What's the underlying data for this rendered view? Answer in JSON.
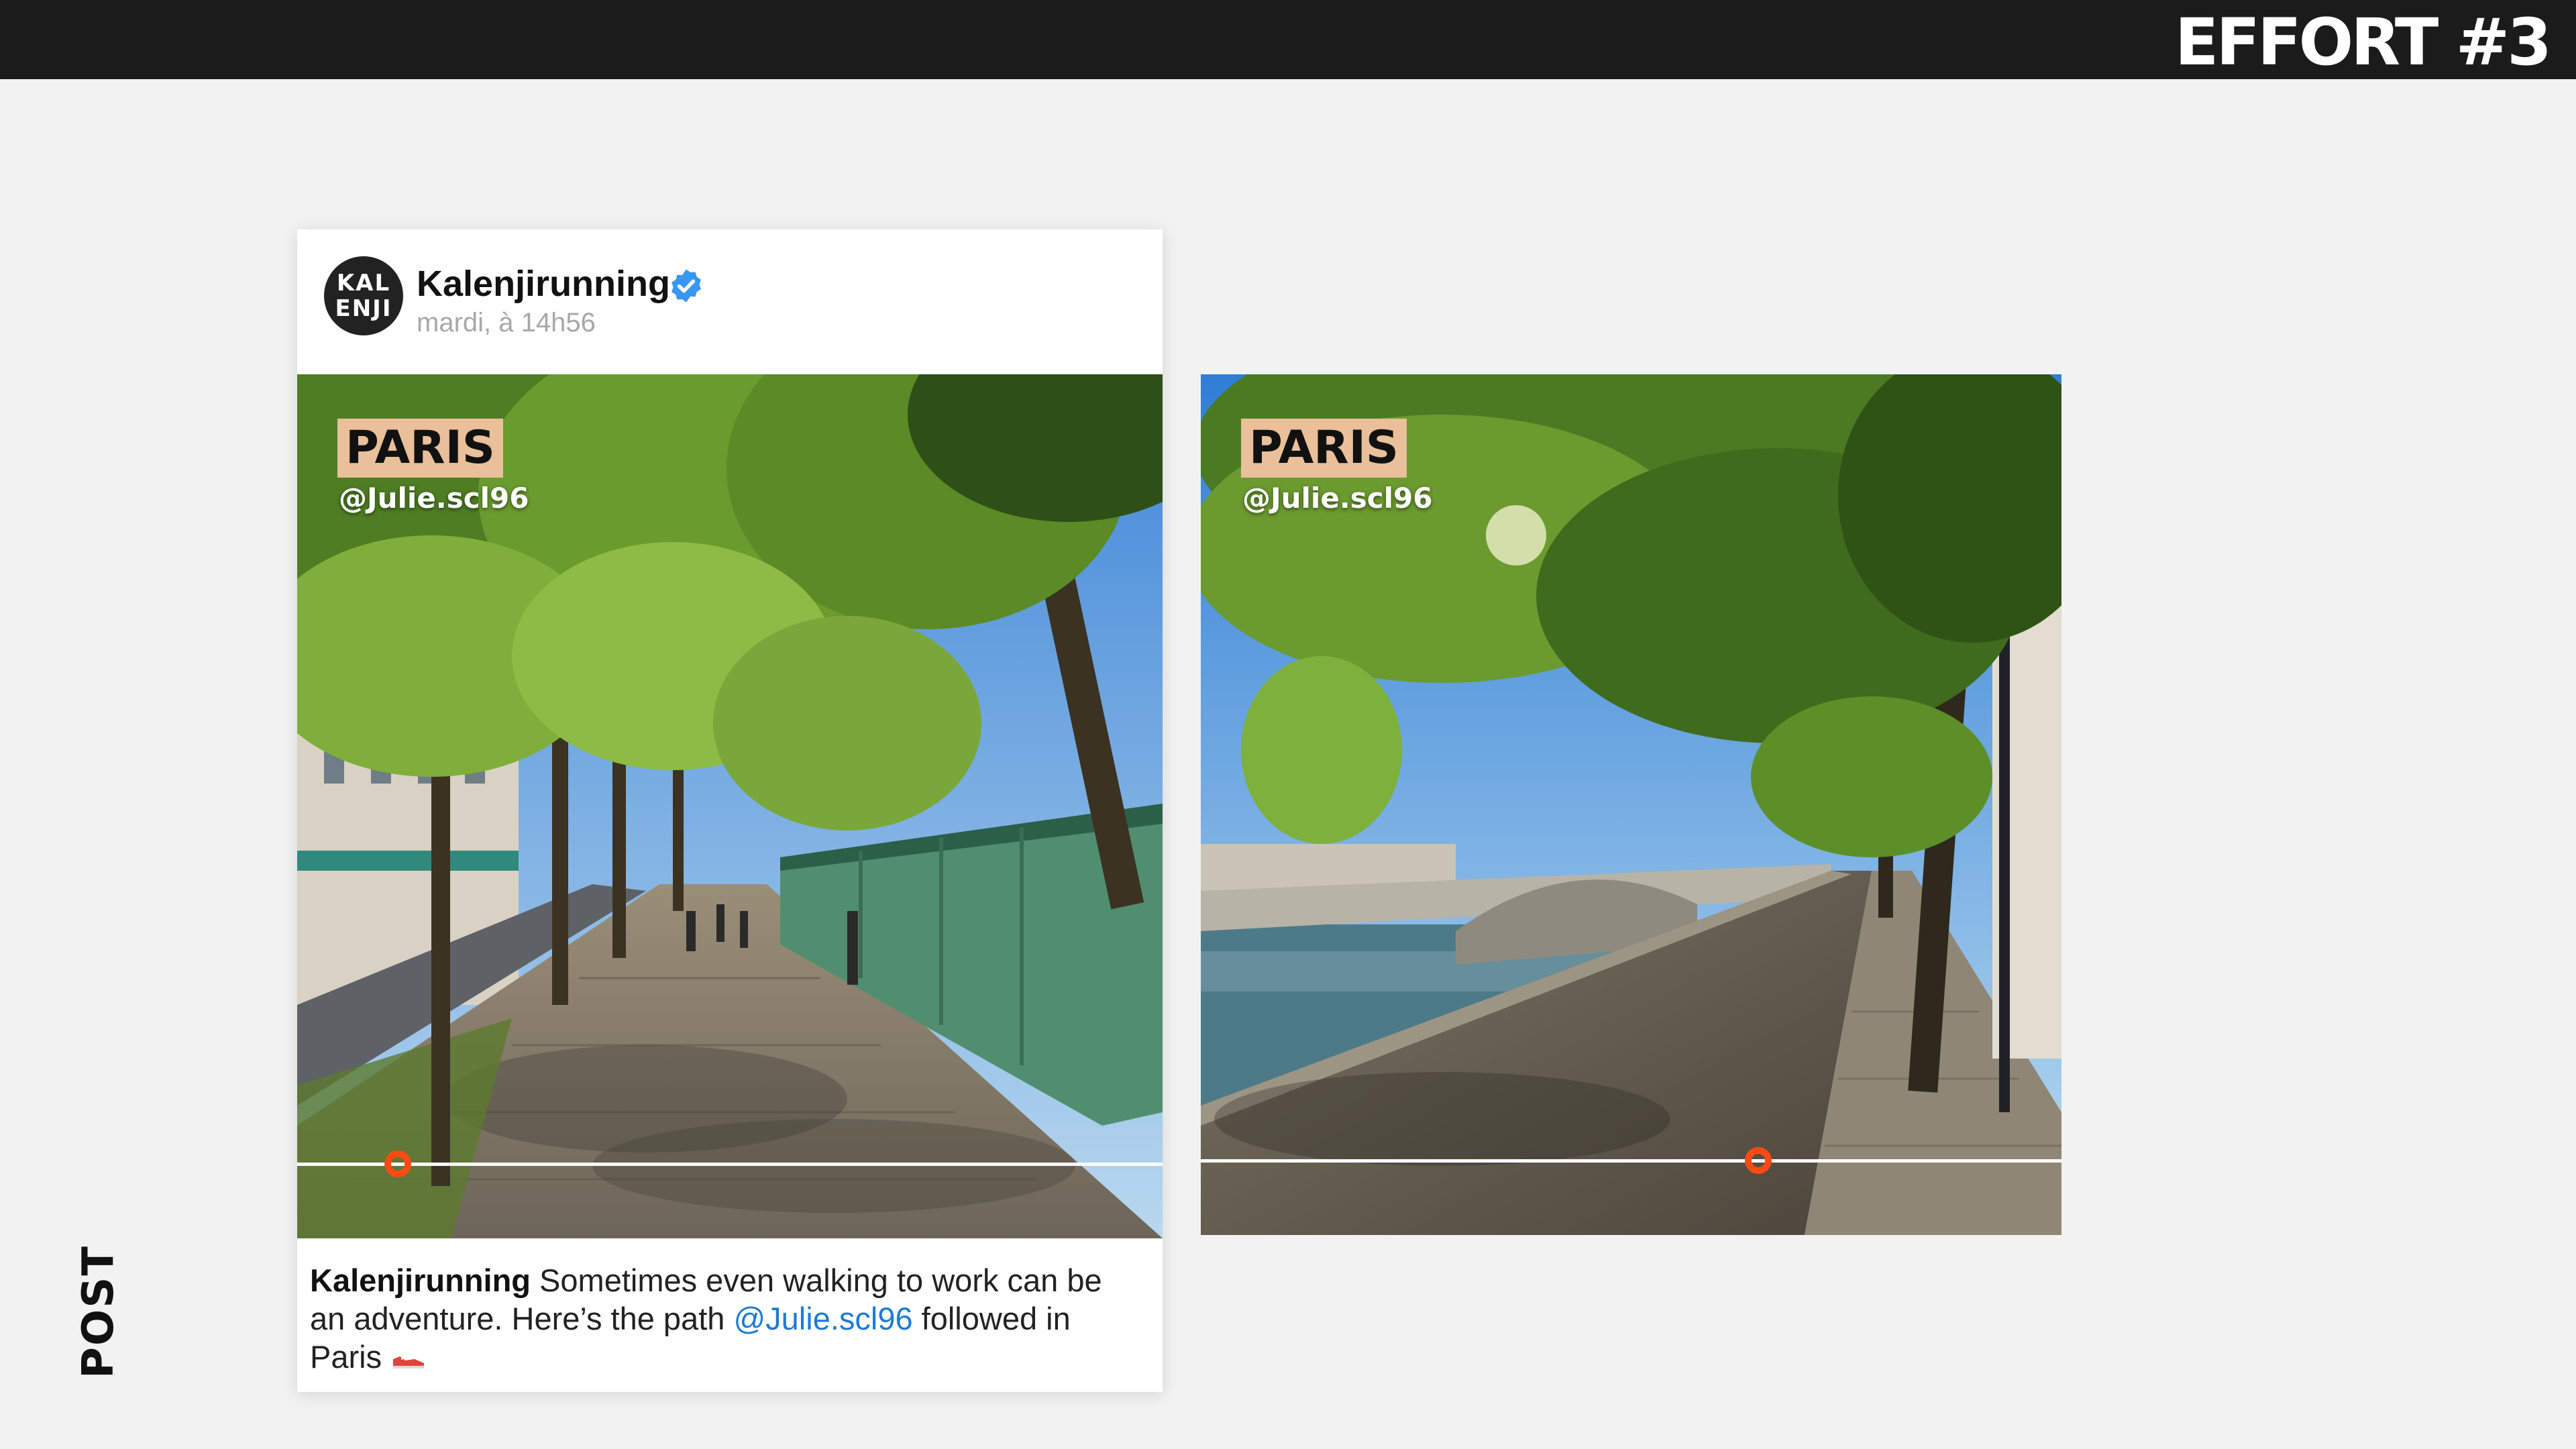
{
  "header": {
    "title": "EFFORT #3"
  },
  "side_label": "POST",
  "post": {
    "avatar_lines": [
      "KAL",
      "ENJI"
    ],
    "account": "Kalenjirunning",
    "time": "mardi, à 14h56",
    "caption": {
      "account": "Kalenjirunning",
      "text_before": " Sometimes even walking to work can be an adventure. Here’s the path ",
      "mention": "@Julie.scl96",
      "text_after": " followed in Paris "
    }
  },
  "slides": [
    {
      "tag": "PARIS",
      "handle": "@Julie.scl96",
      "progress": 0.12
    },
    {
      "tag": "PARIS",
      "handle": "@Julie.scl96",
      "progress": 0.65
    }
  ],
  "colors": {
    "accent": "#ff4a14",
    "tag_bg": "#e9c09a",
    "mention": "#1e7ad6",
    "verified": "#3897f0",
    "topbar": "#1b1b1b"
  },
  "icons": [
    "verified-badge-icon",
    "running-shoe-icon"
  ]
}
